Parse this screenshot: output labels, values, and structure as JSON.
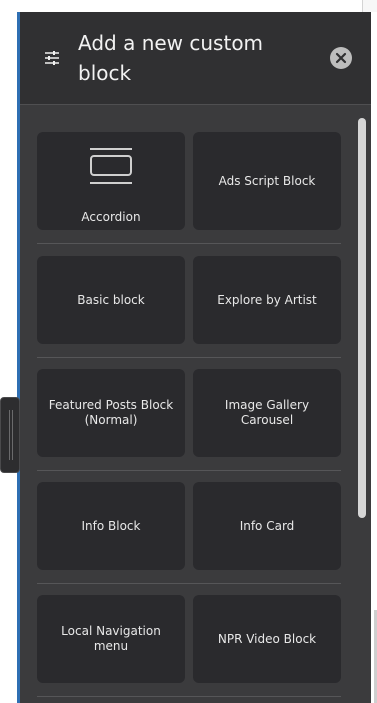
{
  "panel": {
    "title": "Add a new custom block",
    "settings_icon": "sliders-icon",
    "close_icon": "close-icon"
  },
  "blocks": [
    {
      "label": "Accordion",
      "icon": "accordion-icon"
    },
    {
      "label": "Ads Script Block"
    },
    {
      "label": "Basic block"
    },
    {
      "label": "Explore by Artist"
    },
    {
      "label": "Featured Posts Block (Normal)"
    },
    {
      "label": "Image Gallery Carousel"
    },
    {
      "label": "Info Block"
    },
    {
      "label": "Info Card"
    },
    {
      "label": "Local Navigation menu"
    },
    {
      "label": "NPR Video Block"
    }
  ],
  "colors": {
    "panel_bg": "#3b3b3d",
    "header_bg": "#303032",
    "card_bg": "#2a2a2d",
    "accent": "#2f6fb3"
  }
}
